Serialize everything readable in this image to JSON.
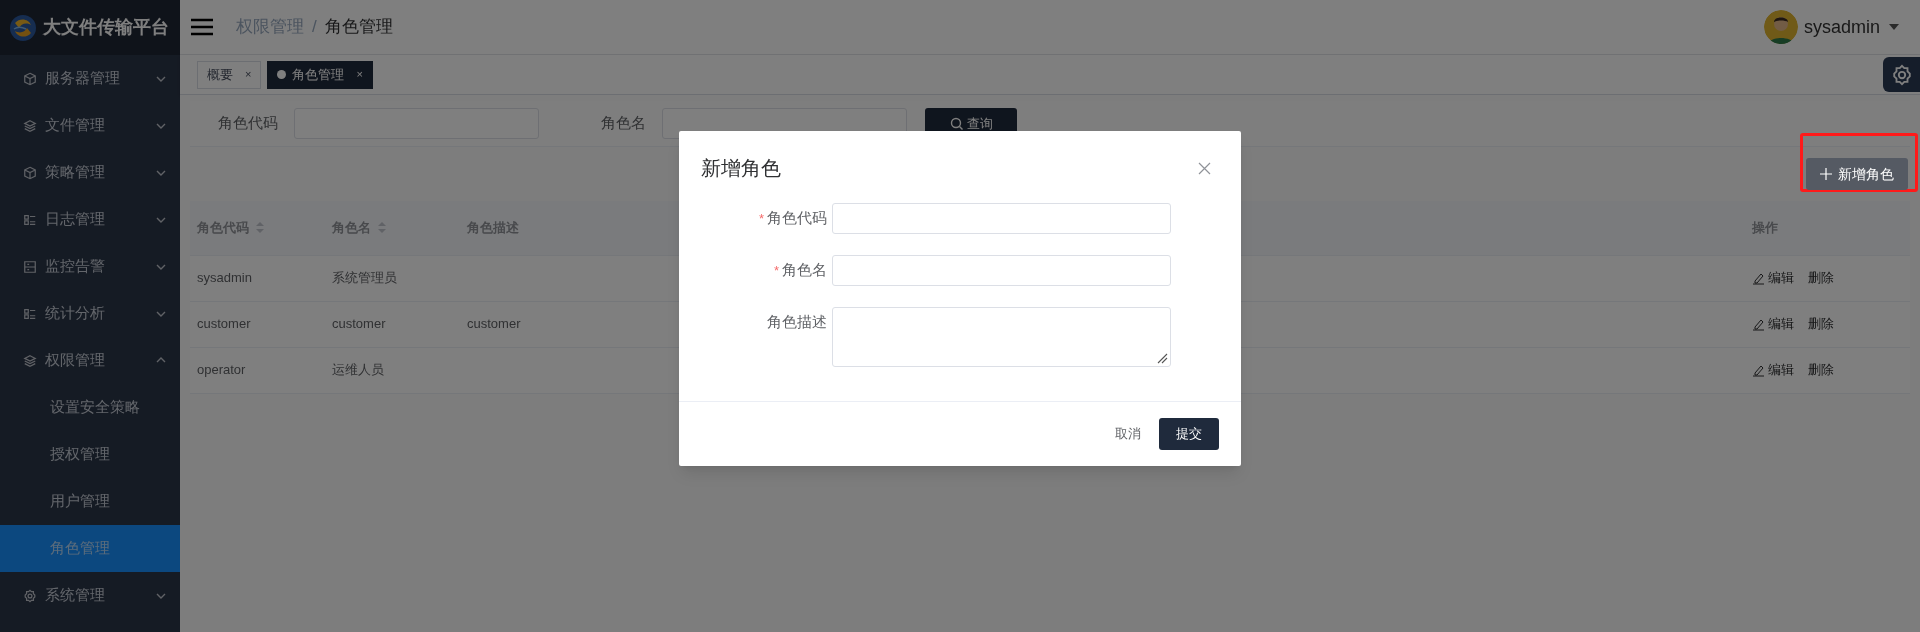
{
  "app": {
    "title": "大文件传输平台"
  },
  "sidebar": {
    "items": [
      {
        "label": "服务器管理",
        "expanded": false
      },
      {
        "label": "文件管理",
        "expanded": false
      },
      {
        "label": "策略管理",
        "expanded": false
      },
      {
        "label": "日志管理",
        "expanded": false
      },
      {
        "label": "监控告警",
        "expanded": false
      },
      {
        "label": "统计分析",
        "expanded": false
      },
      {
        "label": "权限管理",
        "expanded": true,
        "children": [
          {
            "label": "设置安全策略",
            "selected": false
          },
          {
            "label": "授权管理",
            "selected": false
          },
          {
            "label": "用户管理",
            "selected": false
          },
          {
            "label": "角色管理",
            "selected": true
          }
        ]
      },
      {
        "label": "系统管理",
        "expanded": false
      }
    ]
  },
  "breadcrumb": [
    "权限管理",
    "/",
    "角色管理"
  ],
  "user": {
    "name": "sysadmin"
  },
  "tabs": [
    {
      "label": "概要",
      "selected": false
    },
    {
      "label": "角色管理",
      "selected": true
    }
  ],
  "tab_close": "×",
  "search": {
    "fields": [
      {
        "label": "角色代码"
      },
      {
        "label": "角色名"
      }
    ],
    "button": "查询"
  },
  "add_button": "新增角色",
  "table": {
    "columns": [
      {
        "label": "角色代码",
        "sortable": true
      },
      {
        "label": "角色名",
        "sortable": true
      },
      {
        "label": "角色描述",
        "sortable": false
      },
      {
        "label": "操作",
        "sortable": false
      }
    ],
    "rows": [
      {
        "cells": [
          "sysadmin",
          "系统管理员",
          ""
        ],
        "actions": [
          {
            "label": "编辑",
            "kind": "edit"
          },
          {
            "label": "删除",
            "kind": "delete"
          }
        ]
      },
      {
        "cells": [
          "customer",
          "customer",
          "customer"
        ],
        "actions": [
          {
            "label": "编辑",
            "kind": "edit"
          },
          {
            "label": "删除",
            "kind": "delete"
          }
        ]
      },
      {
        "cells": [
          "operator",
          "运维人员",
          ""
        ],
        "actions": [
          {
            "label": "编辑",
            "kind": "edit"
          },
          {
            "label": "删除",
            "kind": "delete"
          }
        ]
      }
    ]
  },
  "dialog": {
    "title": "新增角色",
    "fields": [
      {
        "label": "角色代码",
        "required": true,
        "kind": "input"
      },
      {
        "label": "角色名",
        "required": true,
        "kind": "input"
      },
      {
        "label": "角色描述",
        "required": false,
        "kind": "textarea"
      }
    ],
    "required_mark": "*",
    "buttons": [
      {
        "label": "取消",
        "kind": "text"
      },
      {
        "label": "提交",
        "kind": "primary"
      }
    ]
  }
}
